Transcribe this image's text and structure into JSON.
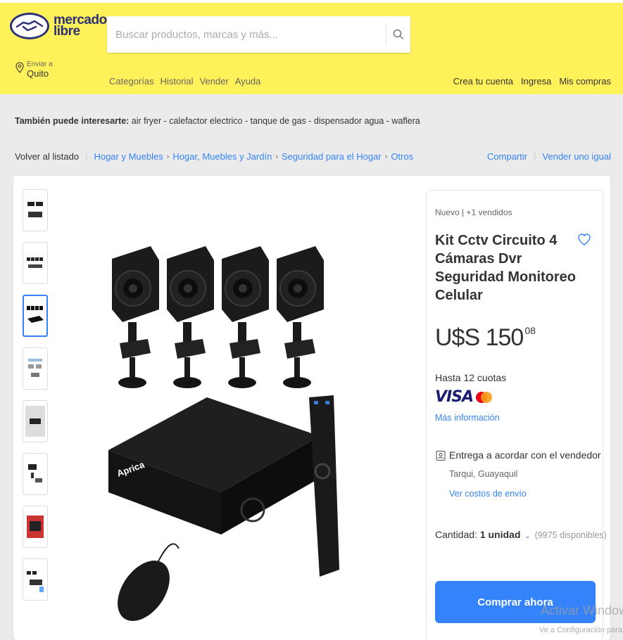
{
  "header": {
    "logo_line1": "mercado",
    "logo_line2": "libre",
    "search_placeholder": "Buscar productos, marcas y más...",
    "location_label": "Enviar a",
    "location_city": "Quito",
    "nav": [
      "Categorías",
      "Historial",
      "Vender",
      "Ayuda"
    ],
    "account_links": [
      "Crea tu cuenta",
      "Ingresa",
      "Mis compras"
    ]
  },
  "interest": {
    "label": "También puede interesarte:",
    "items": "air fryer - calefactor electrico - tanque de gas - dispensador agua - waflera"
  },
  "breadcrumb": {
    "back": "Volver al listado",
    "path": [
      "Hogar y Muebles",
      "Hogar, Muebles y Jardín",
      "Seguridad para el Hogar",
      "Otros"
    ],
    "share": "Compartir",
    "sell": "Vender uno igual"
  },
  "product": {
    "condition": "Nuevo  |  +1 vendidos",
    "title": "Kit Cctv Circuito 4 Cámaras Dvr Seguridad Monitoreo Celular",
    "price_main": "U$S 150",
    "price_cents": "08",
    "installments": "Hasta 12 cuotas",
    "card_visa": "VISA",
    "more_info": "Más información",
    "shipping_title": "Entrega a acordar con el vendedor",
    "shipping_location": "Tarqui, Guayaquil",
    "shipping_link": "Ver costos de envío",
    "quantity_label": "Cantidad:",
    "quantity_value": "1 unidad",
    "quantity_available": "(9975 disponibles)",
    "buy_button": "Comprar ahora",
    "brand_on_dvr": "Aprica"
  },
  "thumbnails": [
    "thumb-1",
    "thumb-2",
    "thumb-3",
    "thumb-4",
    "thumb-5",
    "thumb-6",
    "thumb-7",
    "thumb-8"
  ],
  "watermark": {
    "line1": "Activar Windows",
    "line2": "Ve a Configuración para a"
  },
  "colors": {
    "header_bg": "#fff159",
    "link_blue": "#3483fa",
    "button_blue": "#3483fa"
  }
}
